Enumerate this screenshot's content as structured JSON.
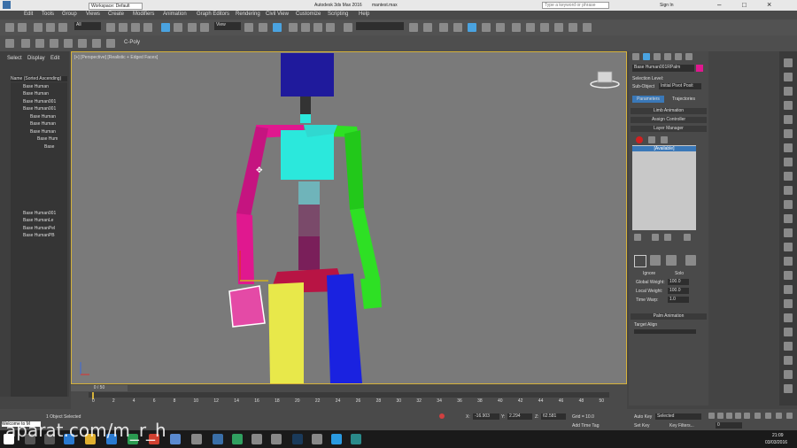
{
  "titlebar": {
    "workspace": "Workspace: Default",
    "app_title": "Autodesk 3ds Max 2016",
    "file": "mantest.max",
    "search_placeholder": "Type a keyword or phrase",
    "sign_in": "Sign In"
  },
  "menu": [
    "Edit",
    "Tools",
    "Group",
    "Views",
    "Create",
    "Modifiers",
    "Animation",
    "Graph Editors",
    "Rendering",
    "Civil View",
    "Customize",
    "Scripting",
    "Help"
  ],
  "toolbar": {
    "selection_filter": "All",
    "view_dropdown": "View"
  },
  "ribbon": {
    "label": "C-Poly"
  },
  "scene_explorer": {
    "tabs": [
      "Select",
      "Display",
      "Edit"
    ],
    "header": "Name (Sorted Ascending)",
    "items": [
      "Base Human",
      "Base Human",
      "Base Human001",
      "Base Human001",
      "Base Human",
      "Base Human",
      "Base Human",
      "Base Hum",
      "Base",
      "Base Human001",
      "Base HumanLe",
      "Base HumanPel",
      "Base HumanPB"
    ]
  },
  "viewport": {
    "label": "[+] [Perspective] [Realistic + Edged Faces]"
  },
  "command_panel": {
    "object_name": "Base Human001RPalm",
    "selection_level": "Selection Level:",
    "sub_object_label": "Sub-Object",
    "sub_object_value": "Initial Pivot Posit",
    "tabs": [
      "Parameters",
      "Trajectories"
    ],
    "rollouts": [
      "Limb Animation",
      "Assign Controller",
      "Layer Manager",
      "Palm Animation"
    ],
    "layer_list_item": "[Available]",
    "options": [
      "Ignore",
      "Solo"
    ],
    "weights": [
      {
        "label": "Global Weight:",
        "value": "100.0"
      },
      {
        "label": "Local Weight:",
        "value": "100.0"
      },
      {
        "label": "Time Warp:",
        "value": "1.0"
      }
    ],
    "target_align": "Target Align"
  },
  "timeline": {
    "frame_display": "0 / 50",
    "ticks": [
      "0",
      "2",
      "4",
      "6",
      "8",
      "10",
      "12",
      "14",
      "16",
      "18",
      "20",
      "22",
      "24",
      "26",
      "28",
      "30",
      "32",
      "34",
      "36",
      "38",
      "40",
      "42",
      "44",
      "46",
      "48",
      "50"
    ]
  },
  "status": {
    "selected": "1 Object Selected",
    "welcome": "Welcome to M",
    "x": "-16.903",
    "y": "2.294",
    "z": "62.581",
    "grid": "Grid = 10.0",
    "add_time_tag": "Add Time Tag",
    "auto_key": "Auto Key",
    "auto_key_value": "Selected",
    "set_key": "Set Key",
    "key_filters": "Key Filters...",
    "frame": "0"
  },
  "taskbar": {
    "time": "21:09",
    "date": "03/03/2016"
  },
  "watermark": "aparat.com/m_r_h",
  "colors": {
    "head": "#1f1a9c",
    "torso": "#2be8dc",
    "left_arm": "#e0188f",
    "right_arm": "#2ee024",
    "left_leg": "#e8e84a",
    "right_leg": "#1a22e0",
    "pelvis": "#b81444",
    "spine": "#7a1f5a",
    "accent": "#4aa3e0"
  }
}
